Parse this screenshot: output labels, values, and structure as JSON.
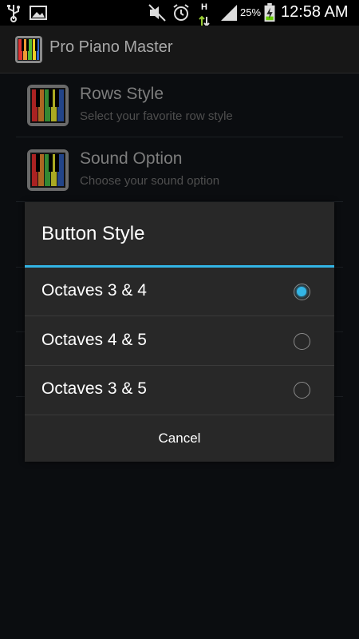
{
  "status_bar": {
    "battery_percent": "25%",
    "time": "12:58 AM",
    "network_label": "H",
    "icons": [
      "usb-icon",
      "image-icon",
      "silent-icon",
      "alarm-icon",
      "network-data-icon",
      "signal-icon",
      "battery-charging-icon"
    ]
  },
  "action_bar": {
    "title": "Pro Piano Master",
    "icon": "piano-keys-icon"
  },
  "preferences": [
    {
      "title": "Rows Style",
      "subtitle": "Select your favorite row style",
      "icon": "piano-keys-icon"
    },
    {
      "title": "Sound Option",
      "subtitle": "Choose your sound option",
      "icon": "piano-keys-icon"
    }
  ],
  "dialog": {
    "title": "Button Style",
    "options": [
      {
        "label": "Octaves 3 & 4",
        "checked": true
      },
      {
        "label": "Octaves 4 & 5",
        "checked": false
      },
      {
        "label": "Octaves 3 & 5",
        "checked": false
      }
    ],
    "cancel_label": "Cancel"
  },
  "colors": {
    "accent": "#33b5e5",
    "dialog_bg": "#282828",
    "screen_bg": "#0b0d10"
  }
}
